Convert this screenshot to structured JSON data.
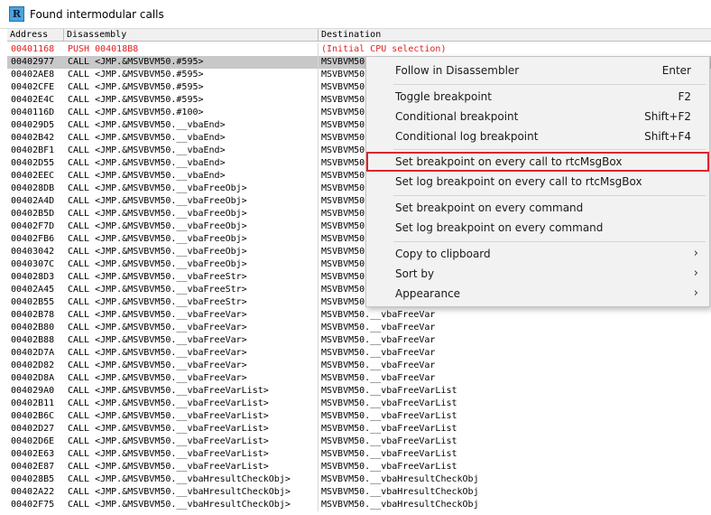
{
  "window": {
    "title": "Found intermodular calls",
    "icon_letter": "R"
  },
  "columns": {
    "address": "Address",
    "disassembly": "Disassembly",
    "destination": "Destination"
  },
  "rows": [
    {
      "address": "00401168",
      "disasm": "PUSH 004018B8",
      "dest": "(Initial CPU selection)",
      "initial": true
    },
    {
      "address": "00402977",
      "disasm": "CALL <JMP.&MSVBVM50.#595>",
      "dest": "MSVBVM50.",
      "selected": true
    },
    {
      "address": "00402AE8",
      "disasm": "CALL <JMP.&MSVBVM50.#595>",
      "dest": "MSVBVM50."
    },
    {
      "address": "00402CFE",
      "disasm": "CALL <JMP.&MSVBVM50.#595>",
      "dest": "MSVBVM50."
    },
    {
      "address": "00402E4C",
      "disasm": "CALL <JMP.&MSVBVM50.#595>",
      "dest": "MSVBVM50."
    },
    {
      "address": "0040116D",
      "disasm": "CALL <JMP.&MSVBVM50.#100>",
      "dest": "MSVBVM50."
    },
    {
      "address": "004029D5",
      "disasm": "CALL <JMP.&MSVBVM50.__vbaEnd>",
      "dest": "MSVBVM50."
    },
    {
      "address": "00402B42",
      "disasm": "CALL <JMP.&MSVBVM50.__vbaEnd>",
      "dest": "MSVBVM50."
    },
    {
      "address": "00402BF1",
      "disasm": "CALL <JMP.&MSVBVM50.__vbaEnd>",
      "dest": "MSVBVM50."
    },
    {
      "address": "00402D55",
      "disasm": "CALL <JMP.&MSVBVM50.__vbaEnd>",
      "dest": "MSVBVM50."
    },
    {
      "address": "00402EEC",
      "disasm": "CALL <JMP.&MSVBVM50.__vbaEnd>",
      "dest": "MSVBVM50."
    },
    {
      "address": "004028DB",
      "disasm": "CALL <JMP.&MSVBVM50.__vbaFreeObj>",
      "dest": "MSVBVM50."
    },
    {
      "address": "00402A4D",
      "disasm": "CALL <JMP.&MSVBVM50.__vbaFreeObj>",
      "dest": "MSVBVM50."
    },
    {
      "address": "00402B5D",
      "disasm": "CALL <JMP.&MSVBVM50.__vbaFreeObj>",
      "dest": "MSVBVM50."
    },
    {
      "address": "00402F7D",
      "disasm": "CALL <JMP.&MSVBVM50.__vbaFreeObj>",
      "dest": "MSVBVM50."
    },
    {
      "address": "00402FB6",
      "disasm": "CALL <JMP.&MSVBVM50.__vbaFreeObj>",
      "dest": "MSVBVM50."
    },
    {
      "address": "00403042",
      "disasm": "CALL <JMP.&MSVBVM50.__vbaFreeObj>",
      "dest": "MSVBVM50."
    },
    {
      "address": "0040307C",
      "disasm": "CALL <JMP.&MSVBVM50.__vbaFreeObj>",
      "dest": "MSVBVM50."
    },
    {
      "address": "004028D3",
      "disasm": "CALL <JMP.&MSVBVM50.__vbaFreeStr>",
      "dest": "MSVBVM50."
    },
    {
      "address": "00402A45",
      "disasm": "CALL <JMP.&MSVBVM50.__vbaFreeStr>",
      "dest": "MSVBVM50."
    },
    {
      "address": "00402B55",
      "disasm": "CALL <JMP.&MSVBVM50.__vbaFreeStr>",
      "dest": "MSVBVM50."
    },
    {
      "address": "00402B78",
      "disasm": "CALL <JMP.&MSVBVM50.__vbaFreeVar>",
      "dest": "MSVBVM50.__vbaFreeVar"
    },
    {
      "address": "00402B80",
      "disasm": "CALL <JMP.&MSVBVM50.__vbaFreeVar>",
      "dest": "MSVBVM50.__vbaFreeVar"
    },
    {
      "address": "00402B88",
      "disasm": "CALL <JMP.&MSVBVM50.__vbaFreeVar>",
      "dest": "MSVBVM50.__vbaFreeVar"
    },
    {
      "address": "00402D7A",
      "disasm": "CALL <JMP.&MSVBVM50.__vbaFreeVar>",
      "dest": "MSVBVM50.__vbaFreeVar"
    },
    {
      "address": "00402D82",
      "disasm": "CALL <JMP.&MSVBVM50.__vbaFreeVar>",
      "dest": "MSVBVM50.__vbaFreeVar"
    },
    {
      "address": "00402D8A",
      "disasm": "CALL <JMP.&MSVBVM50.__vbaFreeVar>",
      "dest": "MSVBVM50.__vbaFreeVar"
    },
    {
      "address": "004029A0",
      "disasm": "CALL <JMP.&MSVBVM50.__vbaFreeVarList>",
      "dest": "MSVBVM50.__vbaFreeVarList"
    },
    {
      "address": "00402B11",
      "disasm": "CALL <JMP.&MSVBVM50.__vbaFreeVarList>",
      "dest": "MSVBVM50.__vbaFreeVarList"
    },
    {
      "address": "00402B6C",
      "disasm": "CALL <JMP.&MSVBVM50.__vbaFreeVarList>",
      "dest": "MSVBVM50.__vbaFreeVarList"
    },
    {
      "address": "00402D27",
      "disasm": "CALL <JMP.&MSVBVM50.__vbaFreeVarList>",
      "dest": "MSVBVM50.__vbaFreeVarList"
    },
    {
      "address": "00402D6E",
      "disasm": "CALL <JMP.&MSVBVM50.__vbaFreeVarList>",
      "dest": "MSVBVM50.__vbaFreeVarList"
    },
    {
      "address": "00402E63",
      "disasm": "CALL <JMP.&MSVBVM50.__vbaFreeVarList>",
      "dest": "MSVBVM50.__vbaFreeVarList"
    },
    {
      "address": "00402E87",
      "disasm": "CALL <JMP.&MSVBVM50.__vbaFreeVarList>",
      "dest": "MSVBVM50.__vbaFreeVarList"
    },
    {
      "address": "004028B5",
      "disasm": "CALL <JMP.&MSVBVM50.__vbaHresultCheckObj>",
      "dest": "MSVBVM50.__vbaHresultCheckObj"
    },
    {
      "address": "00402A22",
      "disasm": "CALL <JMP.&MSVBVM50.__vbaHresultCheckObj>",
      "dest": "MSVBVM50.__vbaHresultCheckObj"
    },
    {
      "address": "00402F75",
      "disasm": "CALL <JMP.&MSVBVM50.__vbaHresultCheckObj>",
      "dest": "MSVBVM50.__vbaHresultCheckObj"
    }
  ],
  "context_menu": {
    "follow": {
      "label": "Follow in Disassembler",
      "shortcut": "Enter"
    },
    "toggle_bp": {
      "label": "Toggle breakpoint",
      "shortcut": "F2"
    },
    "cond_bp": {
      "label": "Conditional breakpoint",
      "shortcut": "Shift+F2"
    },
    "cond_log_bp": {
      "label": "Conditional log breakpoint",
      "shortcut": "Shift+F4"
    },
    "bp_every_call": {
      "label": "Set breakpoint on every call to rtcMsgBox"
    },
    "log_bp_every_call": {
      "label": "Set log breakpoint on every call to rtcMsgBox"
    },
    "bp_every_cmd": {
      "label": "Set breakpoint on every command"
    },
    "log_bp_every_cmd": {
      "label": "Set log breakpoint on every command"
    },
    "copy": {
      "label": "Copy to clipboard",
      "arrow": "›"
    },
    "sort": {
      "label": "Sort by",
      "arrow": "›"
    },
    "appearance": {
      "label": "Appearance",
      "arrow": "›"
    }
  },
  "colors": {
    "highlight_border": "#d9262c",
    "initial_row_text": "#e02020",
    "selected_row": "#c8c8c8"
  }
}
